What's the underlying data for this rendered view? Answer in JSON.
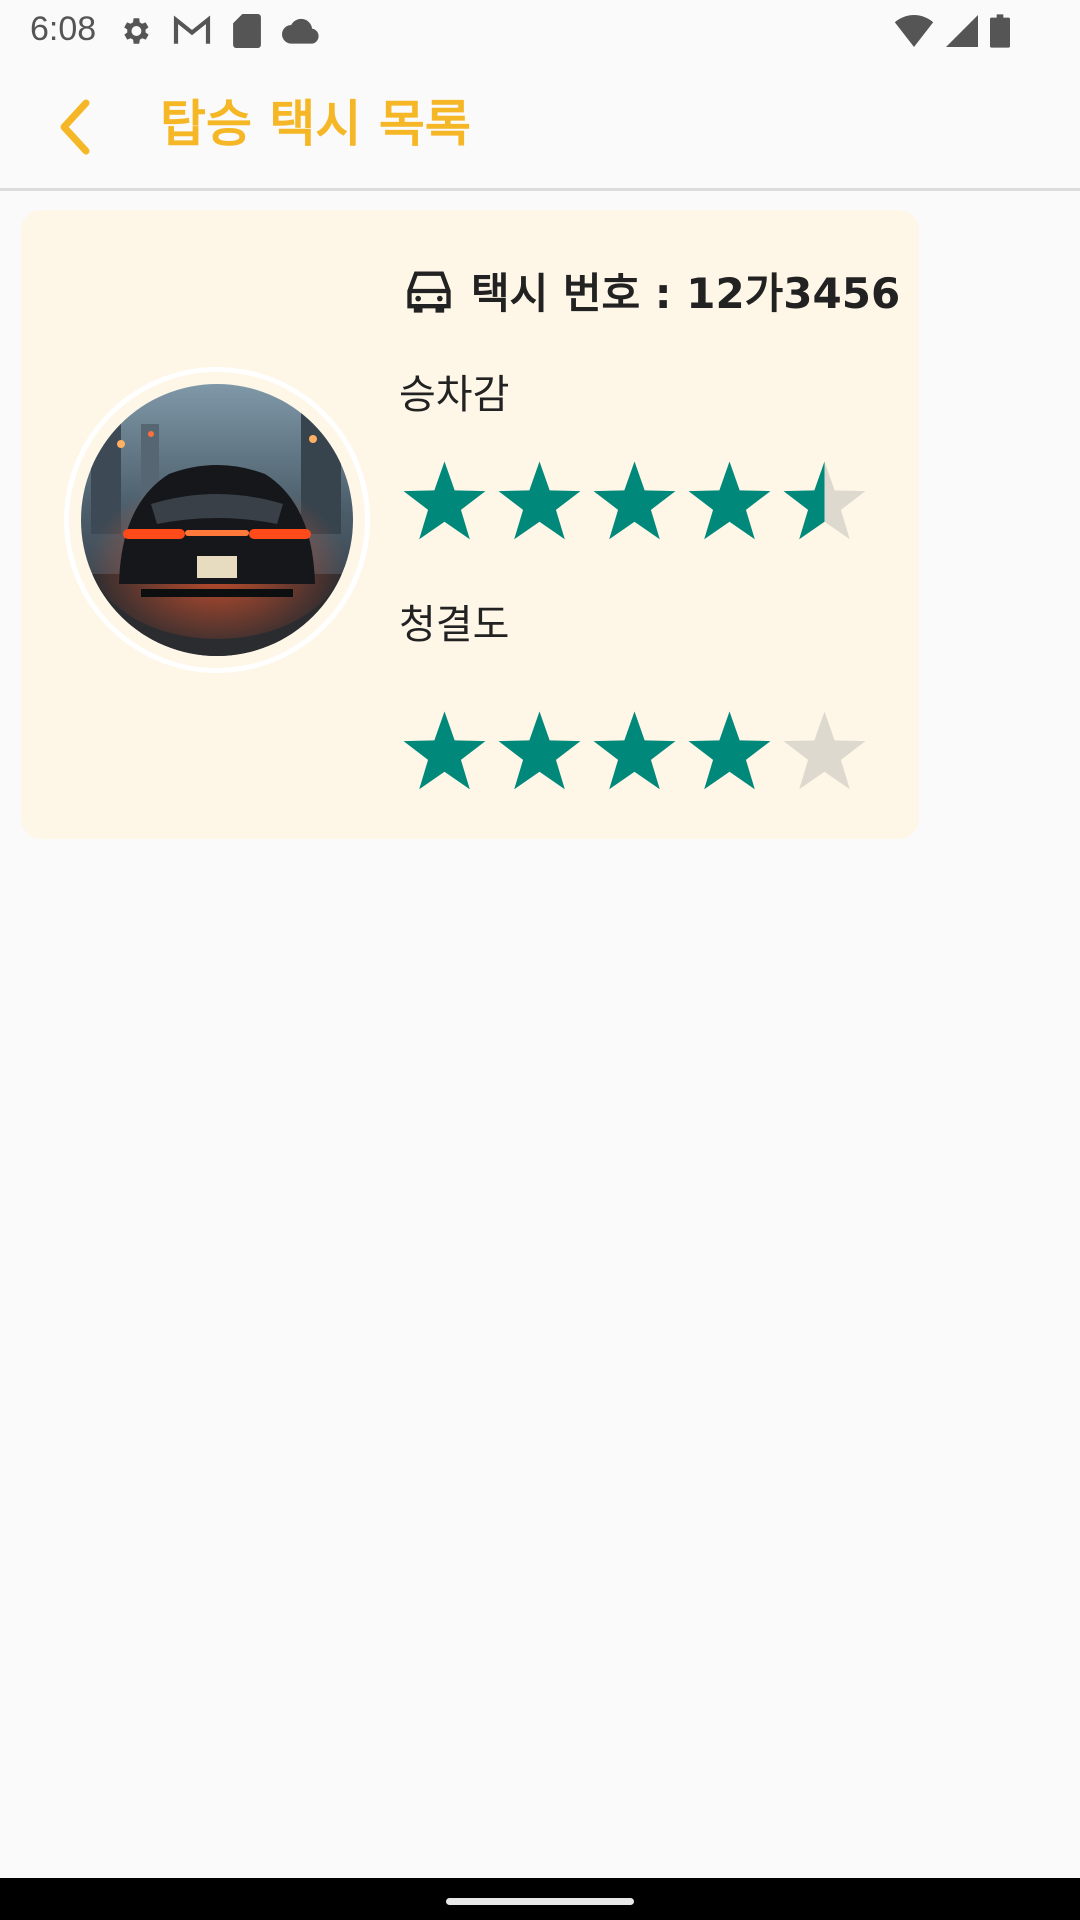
{
  "status_bar": {
    "time": "6:08",
    "left_icons": [
      "gear-icon",
      "gmail-icon",
      "sd-card-icon",
      "cloud-icon"
    ],
    "right_icons": [
      "wifi-icon",
      "cell-signal-icon",
      "battery-icon"
    ]
  },
  "app_bar": {
    "title": "탑승 택시 목록",
    "back_icon": "chevron-left-icon",
    "accent_color": "#f6b727"
  },
  "taxi_card": {
    "background": "#fef7e8",
    "taxi_icon": "taxi-icon",
    "plate_label": "택시 번호 : 12가3456",
    "ratings": [
      {
        "label": "승차감",
        "value": 4.5,
        "max": 5
      },
      {
        "label": "청결도",
        "value": 4.0,
        "max": 5
      }
    ],
    "star_filled_color": "#00897b",
    "star_empty_color": "#ded9cf"
  }
}
